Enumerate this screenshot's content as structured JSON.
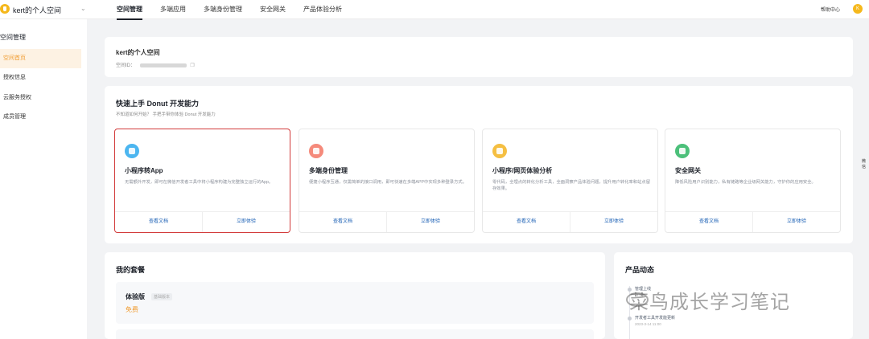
{
  "topbar": {
    "space_name": "kert的个人空间",
    "nav": [
      "空间管理",
      "多端应用",
      "多端身份管理",
      "安全网关",
      "产品体验分析"
    ],
    "help": "帮助中心",
    "avatar_letter": "K"
  },
  "sidebar": {
    "title": "空间管理",
    "items": [
      {
        "label": "空间首页"
      },
      {
        "label": "授权信息"
      },
      {
        "label": "云服务授权"
      },
      {
        "label": "成员管理"
      }
    ]
  },
  "space_info": {
    "name": "kert的个人空间",
    "id_label": "空间ID："
  },
  "quickstart": {
    "title": "快速上手 Donut 开发能力",
    "subtitle": "不知道如何开始？ 手把手带你体验 Donut 开发能力",
    "cards": [
      {
        "icon": "mini-program-icon",
        "color": "#4cb6f0",
        "title": "小程序转App",
        "desc": "无需额外开发，即可在微信开发者工具中将小程序构建为完整独立运行的App。",
        "doc": "查看文档",
        "try": "立即体验"
      },
      {
        "icon": "identity-icon",
        "color": "#f58a7b",
        "title": "多端身份管理",
        "desc": "便捷小程序互通，仅需简单的接口调用，即可快速在多端APP中实现多种登录方式。",
        "doc": "查看文档",
        "try": "立即体验"
      },
      {
        "icon": "analytics-icon",
        "color": "#f5bf42",
        "title": "小程序/网页体验分析",
        "desc": "零代码，全埋点的转化分析工具，全面洞察产品体验问题，提升用户转化率和站点留存效果。",
        "doc": "查看文档",
        "try": "立即体验"
      },
      {
        "icon": "shield-icon",
        "color": "#4cc07a",
        "title": "安全网关",
        "desc": "降低风险用户识别能力，私有链路等企业级网关能力，守护你的应用安全。",
        "doc": "查看文档",
        "try": "立即体验"
      }
    ]
  },
  "plan": {
    "title": "我的套餐",
    "name": "体验版",
    "badge": "基础版本",
    "price": "免费"
  },
  "news": {
    "title": "产品动态",
    "items": [
      {
        "text": "管理上线",
        "date": "11:00"
      },
      {
        "text": "开发者工具开发能更新",
        "date": "2023-3-14 11:00"
      }
    ]
  },
  "watermark": "菜鸟成长学习笔记",
  "edge_text": "微信"
}
